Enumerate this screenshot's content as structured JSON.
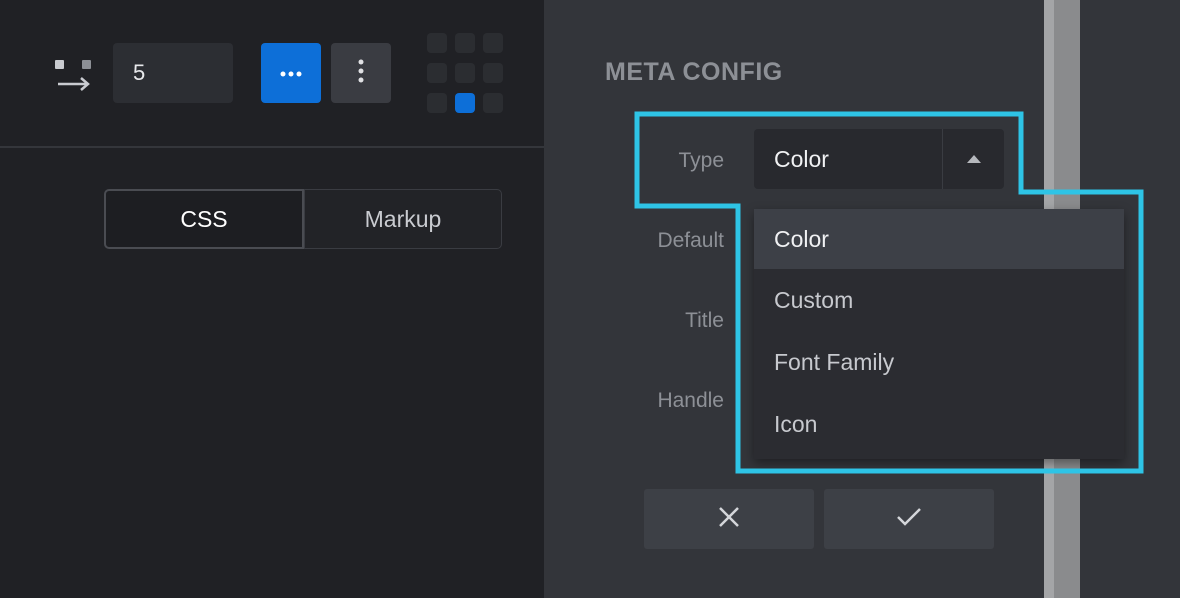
{
  "toolbar": {
    "gap_value": "5",
    "gap_icon": "gap-arrow-icon",
    "more_horizontal_icon": "more-horizontal-icon",
    "more_vertical_icon": "more-vertical-icon",
    "alignment": {
      "rows": 3,
      "cols": 3,
      "active_index": 7
    }
  },
  "tabs": [
    {
      "label": "CSS",
      "active": true
    },
    {
      "label": "Markup",
      "active": false
    }
  ],
  "meta_config": {
    "title": "META CONFIG",
    "labels": {
      "type": "Type",
      "default": "Default",
      "title": "Title",
      "handle": "Handle"
    },
    "type_select": {
      "value": "Color",
      "arrow_icon": "caret-up-icon",
      "options": [
        "Color",
        "Custom",
        "Font Family",
        "Icon"
      ],
      "selected_index": 0
    },
    "actions": {
      "cancel_icon": "close-icon",
      "confirm_icon": "check-icon"
    }
  },
  "colors": {
    "accent_blue": "#0d6fd8",
    "highlight_cyan": "#2ec4e6",
    "left_bg": "#202125",
    "right_bg": "#33353a"
  }
}
